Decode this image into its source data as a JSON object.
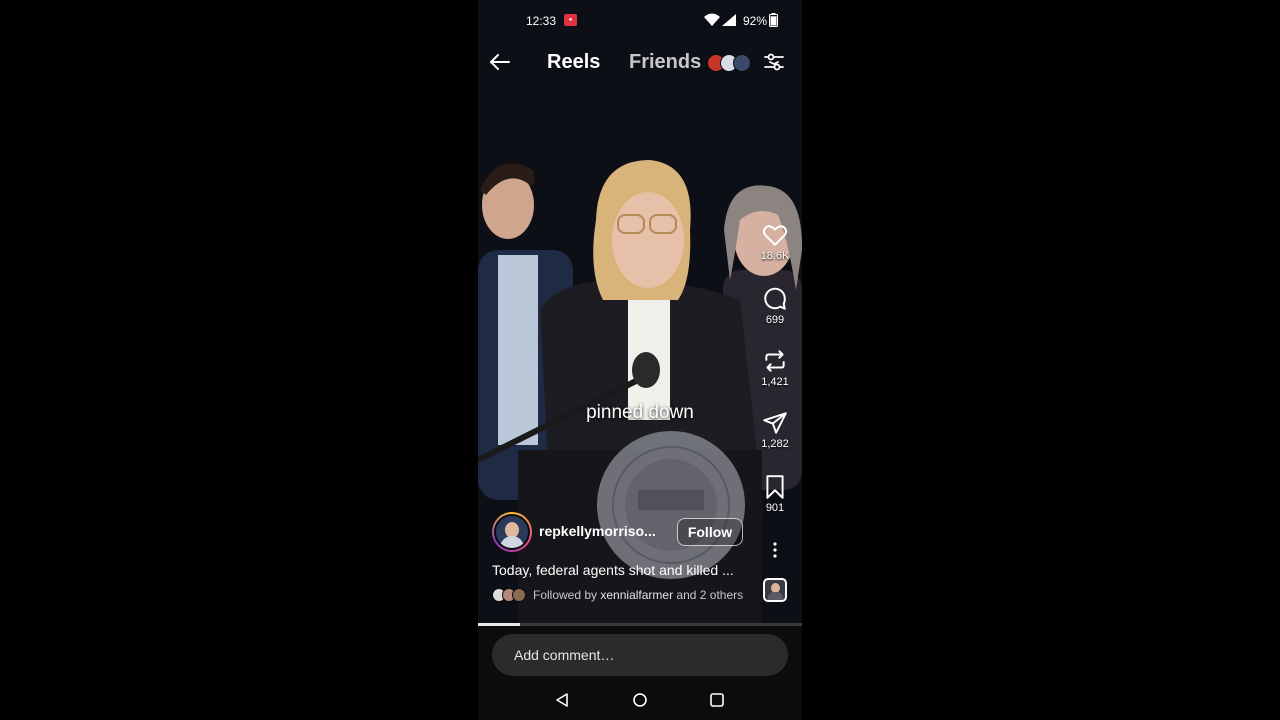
{
  "status_bar": {
    "time": "12:33",
    "battery_percent": "92%",
    "battery_level": 0.92
  },
  "nav": {
    "tab_reels": "Reels",
    "tab_friends": "Friends"
  },
  "video": {
    "subtitle": "pinned down"
  },
  "actions": {
    "likes": "18.6K",
    "comments": "699",
    "reposts": "1,421",
    "shares": "1,282",
    "saves": "901"
  },
  "post": {
    "username": "repkellymorriso...",
    "follow_label": "Follow",
    "caption": "Today, federal agents shot and killed ...",
    "followed_prefix": "Followed by ",
    "followed_user": "xennialfarmer",
    "followed_suffix": " and 2 others",
    "progress": 0.13
  },
  "comment": {
    "placeholder": "Add comment…"
  },
  "colors": {
    "accent_red": "#e0323c",
    "comment_bg": "#2b2b2e"
  }
}
